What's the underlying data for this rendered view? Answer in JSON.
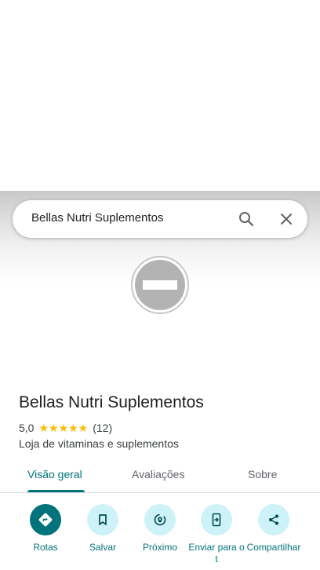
{
  "search": {
    "query": "Bellas Nutri Suplementos"
  },
  "place": {
    "title": "Bellas Nutri Suplementos",
    "rating": "5,0",
    "stars": "★★★★★",
    "review_count": "(12)",
    "category": "Loja de vitaminas e suplementos"
  },
  "tabs": [
    {
      "label": "Visão geral",
      "active": true
    },
    {
      "label": "Avaliações",
      "active": false
    },
    {
      "label": "Sobre",
      "active": false
    }
  ],
  "actions": [
    {
      "label": "Rotas",
      "icon": "directions-icon"
    },
    {
      "label": "Salvar",
      "icon": "bookmark-icon"
    },
    {
      "label": "Próximo",
      "icon": "nearby-icon"
    },
    {
      "label": "Enviar para o t",
      "icon": "send-to-phone-icon"
    },
    {
      "label": "Compartilhar",
      "icon": "share-icon"
    }
  ],
  "colors": {
    "accent": "#00737b",
    "action_bg": "#cdf2f7",
    "star": "#fbbc04",
    "placeholder": "#b3b3b3"
  }
}
